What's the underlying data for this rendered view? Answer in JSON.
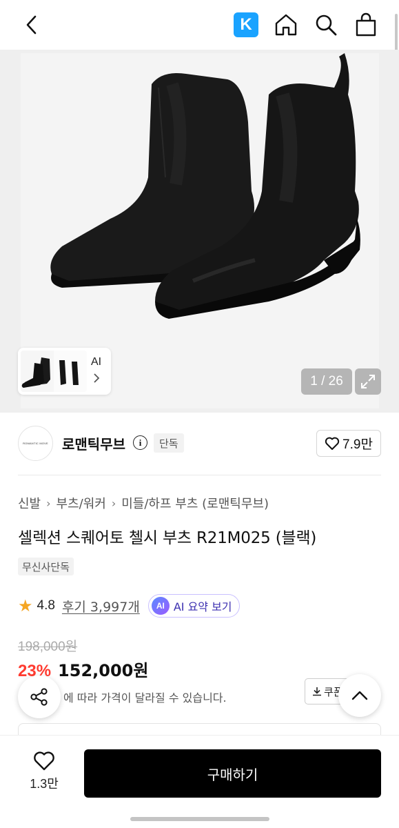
{
  "header": {
    "back_icon": "chevron-left-icon",
    "k_badge": "K",
    "icons": [
      "home-icon",
      "search-icon",
      "shopping-bag-icon"
    ]
  },
  "gallery": {
    "counter": "1 / 26",
    "thumb_label": "AI",
    "expand_icon": "expand-icon"
  },
  "brand": {
    "logo_text": "ROMANTIC MOVE",
    "name": "로맨틱무브",
    "tag": "단독",
    "likes": "7.9만"
  },
  "breadcrumb": [
    "신발",
    "부츠/워커",
    "미들/하프 부츠 (로맨틱무브)"
  ],
  "product": {
    "title": "셀렉션 스퀘어토 첼시 부츠 R21M025 (블랙)",
    "exclusive_tag": "무신사단독",
    "rating": "4.8",
    "reviews": "후기 3,997개",
    "ai_badge": "AI",
    "ai_summary": "AI 요약 보기",
    "original_price": "198,000원",
    "discount": "23%",
    "sale_price": "152,000원",
    "price_note": "에 따라 가격이 달라질 수 있습니다.",
    "coupon_label": "쿠폰"
  },
  "bottom": {
    "wish_count": "1.3만",
    "buy_label": "구매하기"
  },
  "colors": {
    "accent_blue": "#1aa3ff",
    "discount_red": "#ff3b30",
    "star": "#f5a623"
  }
}
